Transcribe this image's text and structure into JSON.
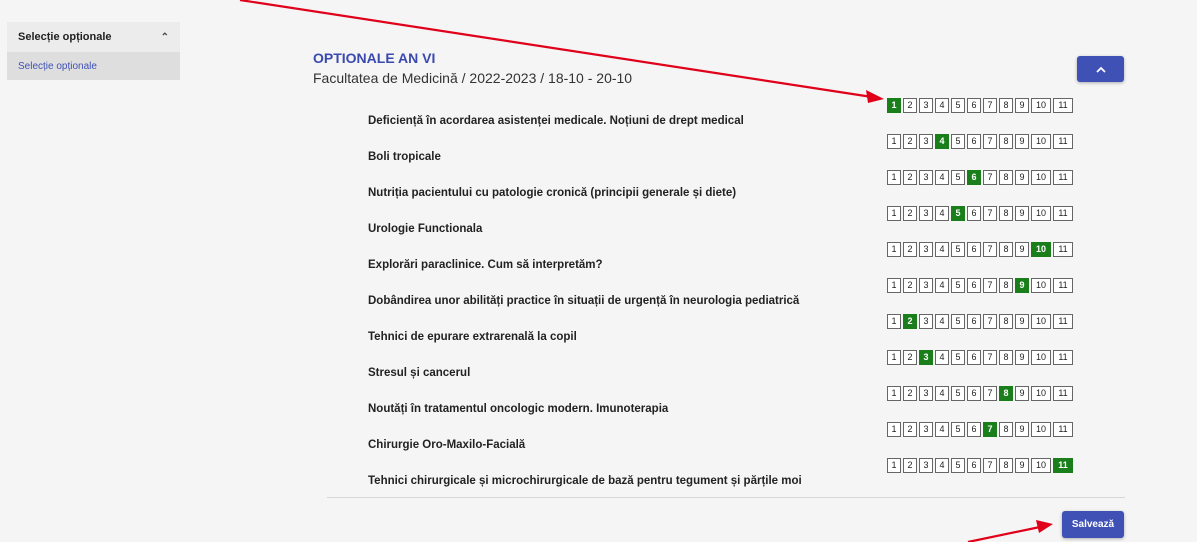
{
  "sidebar": {
    "section_label": "Selecție opționale",
    "item_label": "Selecție opționale"
  },
  "header": {
    "title": "OPTIONALE AN VI",
    "subtitle": "Facultatea de Medicină / 2022-2023 / 18-10 - 20-10"
  },
  "colors": {
    "accent": "#3f51b5",
    "selected": "#1a7f1a",
    "arrow": "#e0001a"
  },
  "rank_options": [
    "1",
    "2",
    "3",
    "4",
    "5",
    "6",
    "7",
    "8",
    "9",
    "10",
    "11"
  ],
  "courses": [
    {
      "name": "Deficiență în acordarea asistenței medicale. Noțiuni de drept medical",
      "selected": "1"
    },
    {
      "name": "Boli tropicale",
      "selected": "4"
    },
    {
      "name": "Nutriția pacientului cu patologie cronică (principii generale și diete)",
      "selected": "6"
    },
    {
      "name": "Urologie Functionala",
      "selected": "5"
    },
    {
      "name": "Explorări paraclinice. Cum să interpretăm?",
      "selected": "10"
    },
    {
      "name": "Dobândirea unor abilități practice în situații de urgență în neurologia pediatrică",
      "selected": "9"
    },
    {
      "name": "Tehnici de epurare extrarenală la copil",
      "selected": "2"
    },
    {
      "name": "Stresul și cancerul",
      "selected": "3"
    },
    {
      "name": "Noutăți în tratamentul oncologic modern. Imunoterapia",
      "selected": "8"
    },
    {
      "name": "Chirurgie Oro-Maxilo-Facială",
      "selected": "7"
    },
    {
      "name": "Tehnici chirurgicale și microchirurgicale de bază pentru tegument și părțile moi",
      "selected": "11"
    }
  ],
  "actions": {
    "save_label": "Salvează",
    "collapse_icon": "chevron-up-icon"
  }
}
